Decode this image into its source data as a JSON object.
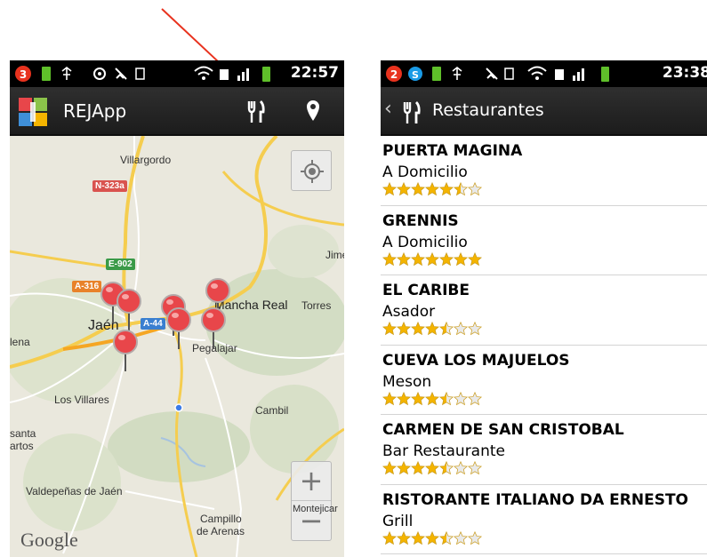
{
  "left_screen": {
    "status_bar": {
      "badge": "3",
      "battery_label": "100",
      "clock": "22:57"
    },
    "action_bar": {
      "title": "REJApp",
      "icons": [
        "app-logo-icon",
        "restaurant-icon",
        "location-pin-icon"
      ]
    },
    "map": {
      "labels": {
        "villargordo": "Villargordo",
        "jimena": "Jime",
        "mancha_real": "Mancha Real",
        "torres": "Torres",
        "jaen": "Jaén",
        "pegalajar": "Pegalajar",
        "lena": "lena",
        "los_villares": "Los Villares",
        "cambil": "Cambil",
        "santa": "santa",
        "martos": "artos",
        "valdepenas": "Valdepeñas de Jaén",
        "campillo": "Campillo",
        "de_arenas": "de Arenas",
        "montejicar": "Montejicar",
        "google": "Google"
      },
      "road_shields": {
        "n323a": "N-323a",
        "e902": "E-902",
        "a316": "A-316",
        "a44": "A-44"
      },
      "zoom_in": "+",
      "zoom_out": "−",
      "pin_count": 8
    }
  },
  "right_screen": {
    "status_bar": {
      "badge": "2",
      "battery_label": "100",
      "clock": "23:38"
    },
    "action_bar": {
      "back": "‹",
      "title": "Restaurantes"
    },
    "restaurants": [
      {
        "name": "PUERTA MAGINA",
        "type": "A Domicilio",
        "rating": 5.5,
        "max": 7
      },
      {
        "name": "GRENNIS",
        "type": "A Domicilio",
        "rating": 7,
        "max": 7
      },
      {
        "name": "EL CARIBE",
        "type": "Asador",
        "rating": 4.5,
        "max": 7
      },
      {
        "name": "CUEVA LOS MAJUELOS",
        "type": "Meson",
        "rating": 4.5,
        "max": 7
      },
      {
        "name": "CARMEN DE SAN CRISTOBAL",
        "type": "Bar Restaurante",
        "rating": 4.5,
        "max": 7
      },
      {
        "name": "RISTORANTE ITALIANO DA ERNESTO",
        "type": "Grill",
        "rating": 4.5,
        "max": 7
      }
    ]
  },
  "colors": {
    "pin": "#e8464a",
    "star": "#f4b400",
    "arrow": "#e8321e",
    "actionbar": "#2a2a2a"
  }
}
